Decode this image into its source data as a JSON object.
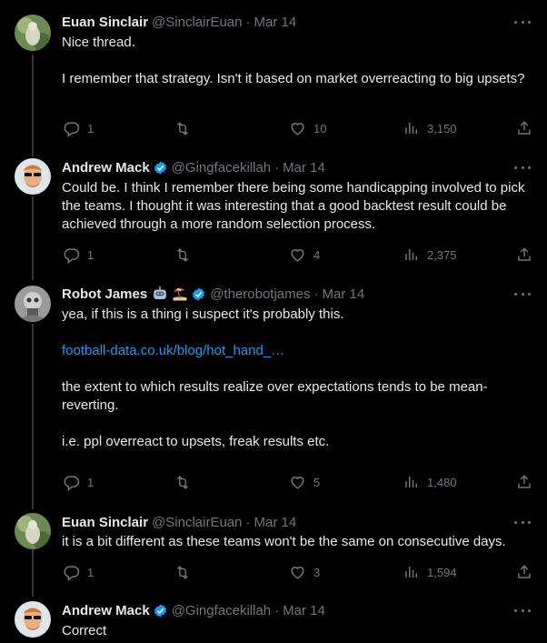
{
  "tweets": [
    {
      "name": "Euan Sinclair",
      "handle": "@SinclairEuan",
      "date": "Mar 14",
      "text1": "Nice thread.",
      "text2": "I remember that strategy. Isn't it based on market overreacting to big upsets?",
      "replies": "1",
      "likes": "10",
      "views": "3,150"
    },
    {
      "name": "Andrew Mack",
      "handle": "@Gingfacekillah",
      "date": "Mar 14",
      "text1": "Could be. I think I remember there being some handicapping involved to pick the teams. I thought it was interesting that a good backtest result could be achieved through a more random selection process.",
      "replies": "1",
      "likes": "4",
      "views": "2,375"
    },
    {
      "name": "Robot James",
      "handle": "@therobotjames",
      "date": "Mar 14",
      "text1": "yea, if this is a thing i suspect it's probably this.",
      "link": "football-data.co.uk/blog/hot_hand_…",
      "text2": "the extent to which results realize over expectations tends to be mean-reverting.",
      "text3": "i.e. ppl overreact to upsets, freak results etc.",
      "replies": "1",
      "likes": "5",
      "views": "1,480"
    },
    {
      "name": "Euan Sinclair",
      "handle": "@SinclairEuan",
      "date": "Mar 14",
      "text1": "it is a bit different as these teams won't be the same on consecutive days.",
      "replies": "1",
      "likes": "3",
      "views": "1,594"
    },
    {
      "name": "Andrew Mack",
      "handle": "@Gingfacekillah",
      "date": "Mar 14",
      "text1": "Correct"
    }
  ],
  "ui": {
    "separator": "·"
  },
  "colors": {
    "accent": "#1d9bf0",
    "muted": "#71767b",
    "text": "#e7e9ea",
    "background": "#000000"
  },
  "icons": [
    "reply-icon",
    "retweet-icon",
    "like-icon",
    "views-icon",
    "share-icon",
    "verified-badge-icon",
    "more-icon",
    "robot-emoji-icon",
    "beach-emoji-icon"
  ]
}
